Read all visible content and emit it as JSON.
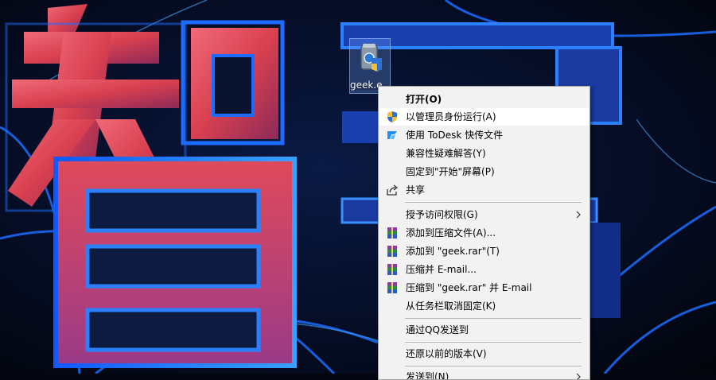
{
  "desktop": {
    "icon_label": "geek.e",
    "icon_semantic": "geek-app-icon"
  },
  "context_menu": {
    "items": [
      {
        "label": "打开(O)",
        "bold": true,
        "icon": null
      },
      {
        "label": "以管理员身份运行(A)",
        "icon": "uac-shield-icon",
        "hover": true
      },
      {
        "label": "使用 ToDesk 快传文件",
        "icon": "todesk-icon"
      },
      {
        "label": "兼容性疑难解答(Y)",
        "icon": null
      },
      {
        "label": "固定到\"开始\"屏幕(P)",
        "icon": null
      },
      {
        "label": "共享",
        "icon": "share-icon"
      },
      {
        "label": "授予访问权限(G)",
        "icon": null,
        "submenu": true
      },
      {
        "label": "添加到压缩文件(A)...",
        "icon": "winrar-icon"
      },
      {
        "label": "添加到 \"geek.rar\"(T)",
        "icon": "winrar-icon"
      },
      {
        "label": "压缩并 E-mail...",
        "icon": "winrar-icon"
      },
      {
        "label": "压缩到 \"geek.rar\" 并 E-mail",
        "icon": "winrar-icon"
      },
      {
        "label": "从任务栏取消固定(K)",
        "icon": null
      },
      {
        "label": "通过QQ发送到",
        "icon": null
      },
      {
        "label": "还原以前的版本(V)",
        "icon": null
      },
      {
        "label": "发送到(N)",
        "icon": null,
        "submenu": true
      }
    ]
  },
  "colors": {
    "menu_bg": "#f2f2f2",
    "menu_hover": "#ffffff",
    "separator": "#b8b8b8",
    "shield_blue": "#2f6fd6",
    "shield_yellow": "#f2c230",
    "todesk_blue": "#1e90ff",
    "wallpaper_red": "#e04858",
    "wallpaper_blue": "#1e6cff"
  }
}
